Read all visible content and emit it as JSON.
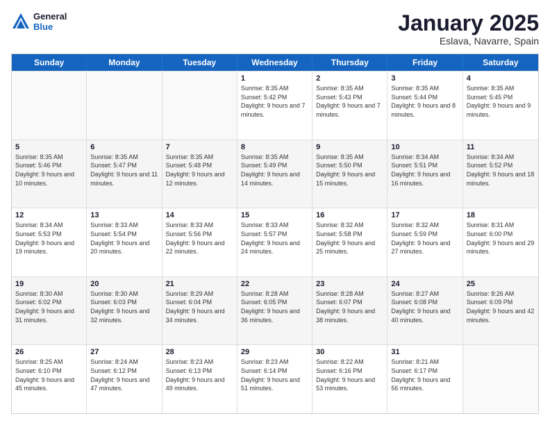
{
  "header": {
    "logo_general": "General",
    "logo_blue": "Blue",
    "month_title": "January 2025",
    "location": "Eslava, Navarre, Spain"
  },
  "days_of_week": [
    "Sunday",
    "Monday",
    "Tuesday",
    "Wednesday",
    "Thursday",
    "Friday",
    "Saturday"
  ],
  "weeks": [
    [
      {
        "day": "",
        "info": ""
      },
      {
        "day": "",
        "info": ""
      },
      {
        "day": "",
        "info": ""
      },
      {
        "day": "1",
        "info": "Sunrise: 8:35 AM\nSunset: 5:42 PM\nDaylight: 9 hours\nand 7 minutes."
      },
      {
        "day": "2",
        "info": "Sunrise: 8:35 AM\nSunset: 5:43 PM\nDaylight: 9 hours\nand 7 minutes."
      },
      {
        "day": "3",
        "info": "Sunrise: 8:35 AM\nSunset: 5:44 PM\nDaylight: 9 hours\nand 8 minutes."
      },
      {
        "day": "4",
        "info": "Sunrise: 8:35 AM\nSunset: 5:45 PM\nDaylight: 9 hours\nand 9 minutes."
      }
    ],
    [
      {
        "day": "5",
        "info": "Sunrise: 8:35 AM\nSunset: 5:46 PM\nDaylight: 9 hours\nand 10 minutes."
      },
      {
        "day": "6",
        "info": "Sunrise: 8:35 AM\nSunset: 5:47 PM\nDaylight: 9 hours\nand 11 minutes."
      },
      {
        "day": "7",
        "info": "Sunrise: 8:35 AM\nSunset: 5:48 PM\nDaylight: 9 hours\nand 12 minutes."
      },
      {
        "day": "8",
        "info": "Sunrise: 8:35 AM\nSunset: 5:49 PM\nDaylight: 9 hours\nand 14 minutes."
      },
      {
        "day": "9",
        "info": "Sunrise: 8:35 AM\nSunset: 5:50 PM\nDaylight: 9 hours\nand 15 minutes."
      },
      {
        "day": "10",
        "info": "Sunrise: 8:34 AM\nSunset: 5:51 PM\nDaylight: 9 hours\nand 16 minutes."
      },
      {
        "day": "11",
        "info": "Sunrise: 8:34 AM\nSunset: 5:52 PM\nDaylight: 9 hours\nand 18 minutes."
      }
    ],
    [
      {
        "day": "12",
        "info": "Sunrise: 8:34 AM\nSunset: 5:53 PM\nDaylight: 9 hours\nand 19 minutes."
      },
      {
        "day": "13",
        "info": "Sunrise: 8:33 AM\nSunset: 5:54 PM\nDaylight: 9 hours\nand 20 minutes."
      },
      {
        "day": "14",
        "info": "Sunrise: 8:33 AM\nSunset: 5:56 PM\nDaylight: 9 hours\nand 22 minutes."
      },
      {
        "day": "15",
        "info": "Sunrise: 8:33 AM\nSunset: 5:57 PM\nDaylight: 9 hours\nand 24 minutes."
      },
      {
        "day": "16",
        "info": "Sunrise: 8:32 AM\nSunset: 5:58 PM\nDaylight: 9 hours\nand 25 minutes."
      },
      {
        "day": "17",
        "info": "Sunrise: 8:32 AM\nSunset: 5:59 PM\nDaylight: 9 hours\nand 27 minutes."
      },
      {
        "day": "18",
        "info": "Sunrise: 8:31 AM\nSunset: 6:00 PM\nDaylight: 9 hours\nand 29 minutes."
      }
    ],
    [
      {
        "day": "19",
        "info": "Sunrise: 8:30 AM\nSunset: 6:02 PM\nDaylight: 9 hours\nand 31 minutes."
      },
      {
        "day": "20",
        "info": "Sunrise: 8:30 AM\nSunset: 6:03 PM\nDaylight: 9 hours\nand 32 minutes."
      },
      {
        "day": "21",
        "info": "Sunrise: 8:29 AM\nSunset: 6:04 PM\nDaylight: 9 hours\nand 34 minutes."
      },
      {
        "day": "22",
        "info": "Sunrise: 8:28 AM\nSunset: 6:05 PM\nDaylight: 9 hours\nand 36 minutes."
      },
      {
        "day": "23",
        "info": "Sunrise: 8:28 AM\nSunset: 6:07 PM\nDaylight: 9 hours\nand 38 minutes."
      },
      {
        "day": "24",
        "info": "Sunrise: 8:27 AM\nSunset: 6:08 PM\nDaylight: 9 hours\nand 40 minutes."
      },
      {
        "day": "25",
        "info": "Sunrise: 8:26 AM\nSunset: 6:09 PM\nDaylight: 9 hours\nand 42 minutes."
      }
    ],
    [
      {
        "day": "26",
        "info": "Sunrise: 8:25 AM\nSunset: 6:10 PM\nDaylight: 9 hours\nand 45 minutes."
      },
      {
        "day": "27",
        "info": "Sunrise: 8:24 AM\nSunset: 6:12 PM\nDaylight: 9 hours\nand 47 minutes."
      },
      {
        "day": "28",
        "info": "Sunrise: 8:23 AM\nSunset: 6:13 PM\nDaylight: 9 hours\nand 49 minutes."
      },
      {
        "day": "29",
        "info": "Sunrise: 8:23 AM\nSunset: 6:14 PM\nDaylight: 9 hours\nand 51 minutes."
      },
      {
        "day": "30",
        "info": "Sunrise: 8:22 AM\nSunset: 6:16 PM\nDaylight: 9 hours\nand 53 minutes."
      },
      {
        "day": "31",
        "info": "Sunrise: 8:21 AM\nSunset: 6:17 PM\nDaylight: 9 hours\nand 56 minutes."
      },
      {
        "day": "",
        "info": ""
      }
    ]
  ]
}
